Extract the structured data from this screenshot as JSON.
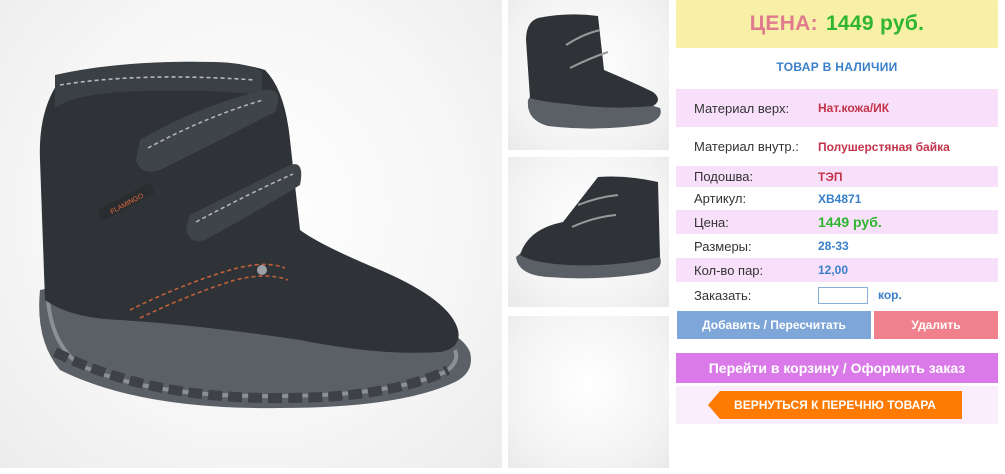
{
  "price_banner": {
    "label": "ЦЕНА:",
    "value": "1449 руб."
  },
  "stock_status": "ТОВАР В НАЛИЧИИ",
  "attributes": [
    {
      "label": "Материал верх:",
      "value": "Нат.кожа/ИК"
    },
    {
      "label": "Материал внутр.:",
      "value": "Полушерстяная байка"
    },
    {
      "label": "Подошва:",
      "value": "ТЭП"
    },
    {
      "label": "Артикул:",
      "value": "XB4871"
    },
    {
      "label": "Цена:",
      "value": "1449 руб."
    },
    {
      "label": "Размеры:",
      "value": "28-33"
    },
    {
      "label": "Кол-во пар:",
      "value": "12,00"
    }
  ],
  "order": {
    "label": "Заказать:",
    "input_value": "",
    "unit": "кор."
  },
  "buttons": {
    "add": "Добавить / Пересчитать",
    "delete": "Удалить",
    "cart": "Перейти в корзину / Оформить заказ",
    "back": "ВЕРНУТЬСЯ К ПЕРЕЧНЮ ТОВАРА"
  },
  "brand_tag": "FLAMINGO",
  "colors": {
    "price_label": "#e07a8e",
    "price_value": "#2fb52f",
    "banner_bg": "#f7f0a6",
    "row_pink": "#f8e0fa",
    "accent_blue": "#3a7fc9",
    "button_add": "#7fa6d8",
    "button_delete": "#f0808b",
    "button_cart": "#d97ae8",
    "button_back": "#ff7a00"
  }
}
